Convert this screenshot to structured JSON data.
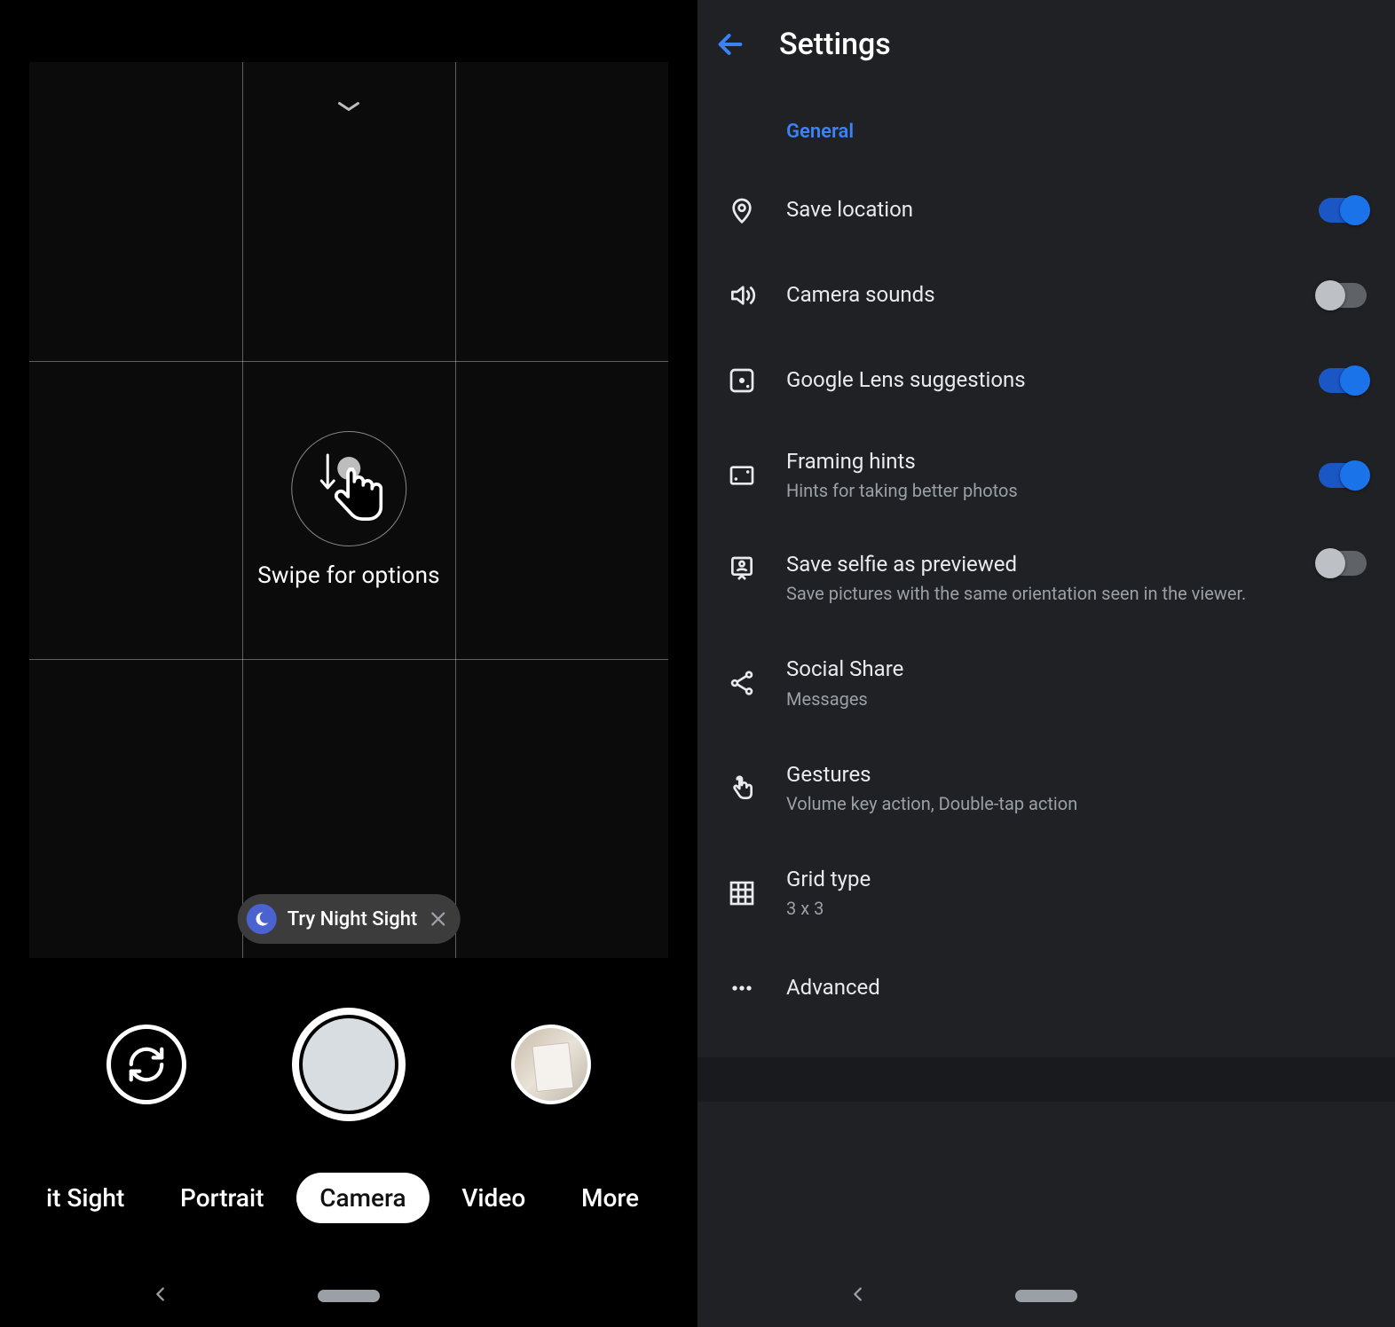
{
  "camera": {
    "swipe_hint": "Swipe for options",
    "night_chip_label": "Try Night Sight",
    "modes": {
      "partial": "it Sight",
      "portrait": "Portrait",
      "camera": "Camera",
      "video": "Video",
      "more": "More"
    }
  },
  "settings": {
    "title": "Settings",
    "section": "General",
    "items": [
      {
        "icon": "location",
        "title": "Save location",
        "sub": "",
        "toggle": "on"
      },
      {
        "icon": "sound",
        "title": "Camera sounds",
        "sub": "",
        "toggle": "off"
      },
      {
        "icon": "lens",
        "title": "Google Lens suggestions",
        "sub": "",
        "toggle": "on"
      },
      {
        "icon": "frame",
        "title": "Framing hints",
        "sub": "Hints for taking better photos",
        "toggle": "on"
      },
      {
        "icon": "selfie",
        "title": "Save selfie as previewed",
        "sub": "Save pictures with the same orientation seen in the viewer.",
        "toggle": "off"
      },
      {
        "icon": "share",
        "title": "Social Share",
        "sub": "Messages",
        "toggle": null
      },
      {
        "icon": "gesture",
        "title": "Gestures",
        "sub": "Volume key action, Double-tap action",
        "toggle": null
      },
      {
        "icon": "grid",
        "title": "Grid type",
        "sub": "3 x 3",
        "toggle": null
      },
      {
        "icon": "dots",
        "title": "Advanced",
        "sub": "",
        "toggle": null
      }
    ]
  }
}
